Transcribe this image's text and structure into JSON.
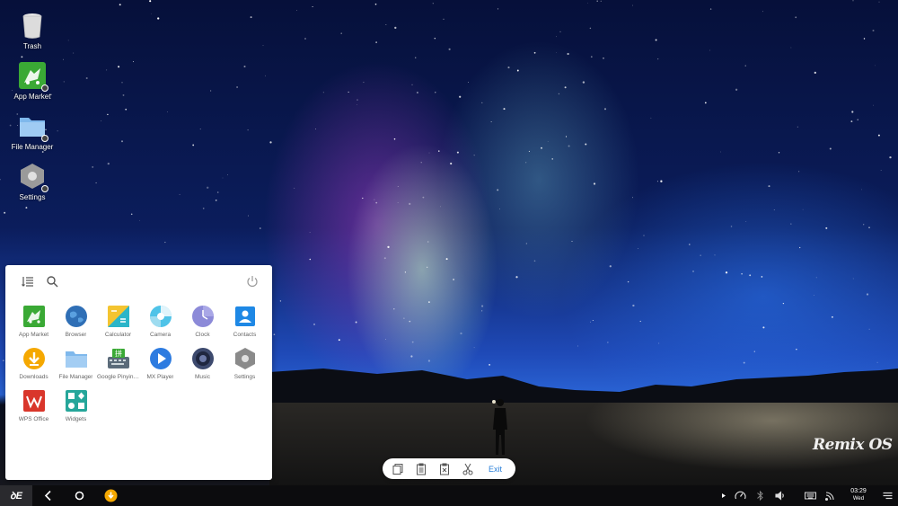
{
  "desktop": {
    "icons": [
      {
        "label": "Trash",
        "icon": "trash-icon"
      },
      {
        "label": "App Market",
        "icon": "app-market-icon"
      },
      {
        "label": "File Manager",
        "icon": "folder-icon"
      },
      {
        "label": "Settings",
        "icon": "settings-hex-icon"
      }
    ],
    "wallpaper_logo": "Remix OS"
  },
  "start_menu": {
    "apps": [
      {
        "label": "App Market",
        "icon": "app-market-icon",
        "color": "#3aa935"
      },
      {
        "label": "Browser",
        "icon": "globe-icon",
        "color": "#2f6fb6"
      },
      {
        "label": "Calculator",
        "icon": "calculator-icon",
        "color": "#f4c430"
      },
      {
        "label": "Camera",
        "icon": "camera-icon",
        "color": "#4fc3e8"
      },
      {
        "label": "Clock",
        "icon": "clock-icon",
        "color": "#8c8ad8"
      },
      {
        "label": "Contacts",
        "icon": "contacts-icon",
        "color": "#1e88e5"
      },
      {
        "label": "Downloads",
        "icon": "download-icon",
        "color": "#f5a800"
      },
      {
        "label": "File Manager",
        "icon": "folder-icon",
        "color": "#8fc4f0"
      },
      {
        "label": "Google Pinyin I...",
        "icon": "keyboard-icon",
        "color": "#5b6b7a"
      },
      {
        "label": "MX Player",
        "icon": "play-icon",
        "color": "#2d7be0"
      },
      {
        "label": "Music",
        "icon": "speaker-icon",
        "color": "#3d4a6e"
      },
      {
        "label": "Settings",
        "icon": "settings-hex-icon",
        "color": "#8a8a8a"
      },
      {
        "label": "WPS Office",
        "icon": "wps-icon",
        "color": "#d9362b"
      },
      {
        "label": "Widgets",
        "icon": "widgets-icon",
        "color": "#26a69a"
      }
    ]
  },
  "clipboard_bar": {
    "exit_label": "Exit"
  },
  "taskbar": {
    "start_label": "ꝺE",
    "time": "03:29",
    "day": "Wed"
  },
  "colors": {
    "accent": "#2a7fd8",
    "taskbar": "#0c0c0e",
    "download_badge": "#f5a800"
  }
}
